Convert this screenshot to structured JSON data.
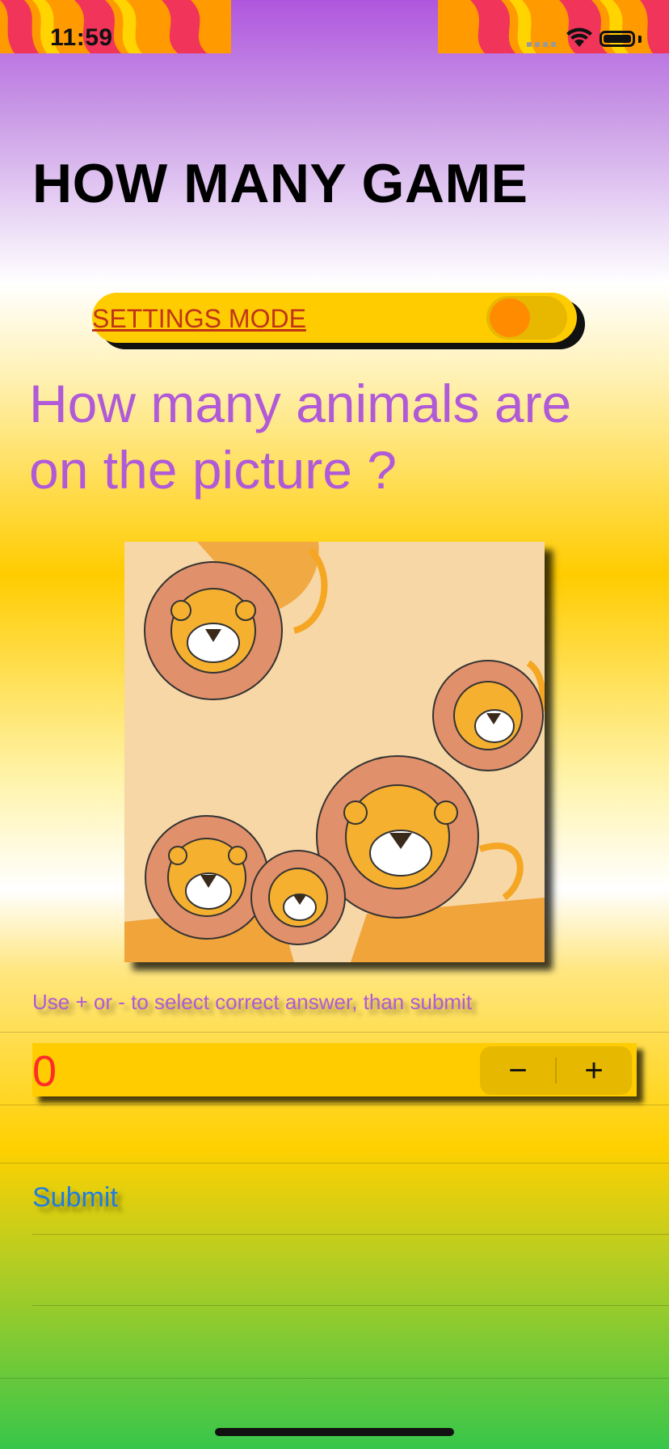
{
  "status_bar": {
    "time": "11:59"
  },
  "page": {
    "title": "HOW MANY GAME"
  },
  "settings": {
    "label": "SETTINGS MODE",
    "enabled": false
  },
  "question": {
    "text": "How many animals are on the picture ?"
  },
  "image": {
    "subject": "cartoon lions"
  },
  "instructions": {
    "text": "Use + or - to select correct answer, than submit"
  },
  "answer": {
    "value": "0",
    "decrement": "−",
    "increment": "+"
  },
  "actions": {
    "submit_label": "Submit"
  },
  "colors": {
    "accent": "#ffcc00",
    "question": "#b05ad8",
    "value": "#ff2b2b",
    "link": "#1f7de0"
  }
}
